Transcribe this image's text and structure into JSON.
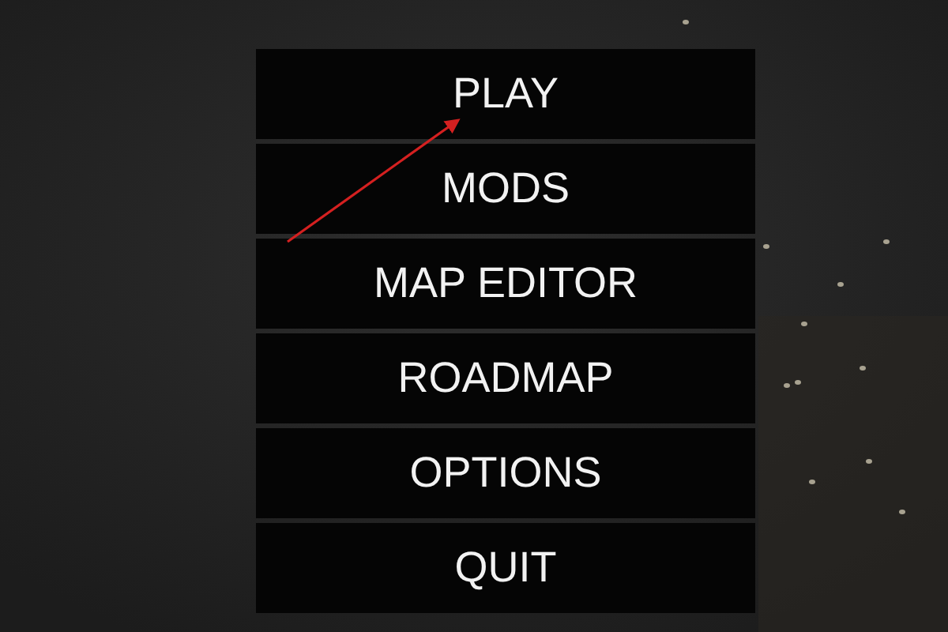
{
  "menu": [
    {
      "label": "PLAY"
    },
    {
      "label": "MODS"
    },
    {
      "label": "MAP EDITOR"
    },
    {
      "label": "ROADMAP"
    },
    {
      "label": "OPTIONS"
    },
    {
      "label": "QUIT"
    }
  ]
}
